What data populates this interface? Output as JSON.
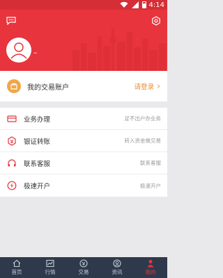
{
  "status_bar": {
    "time": "4:14",
    "icons": [
      "wifi-icon",
      "signal-icon",
      "battery-icon"
    ]
  },
  "header": {
    "user_name": "–",
    "icons": [
      "message-icon",
      "settings-icon",
      "avatar-icon"
    ],
    "background_color": "#e8343c"
  },
  "account": {
    "label": "我的交易账户",
    "action": "请登录",
    "icon": "wallet-icon"
  },
  "menu": [
    {
      "label": "业务办理",
      "desc": "足不出户办业务",
      "icon": "card-icon"
    },
    {
      "label": "银证转账",
      "desc": "转入资金做交易",
      "icon": "transfer-icon"
    },
    {
      "label": "联系客服",
      "desc": "联系客服",
      "icon": "headset-icon"
    },
    {
      "label": "极速开户",
      "desc": "极速开户",
      "icon": "lightning-icon"
    }
  ],
  "nav": [
    {
      "label": "首页",
      "icon": "home-icon"
    },
    {
      "label": "行情",
      "icon": "chart-icon"
    },
    {
      "label": "交易",
      "icon": "trade-icon"
    },
    {
      "label": "资讯",
      "icon": "news-icon"
    },
    {
      "label": "我的",
      "icon": "profile-icon"
    }
  ],
  "nav_active_index": 4,
  "colors": {
    "accent": "#e8343c",
    "nav_bg": "#2e3a4c",
    "login": "#f08a2b",
    "account_icon": "#f0a748"
  }
}
